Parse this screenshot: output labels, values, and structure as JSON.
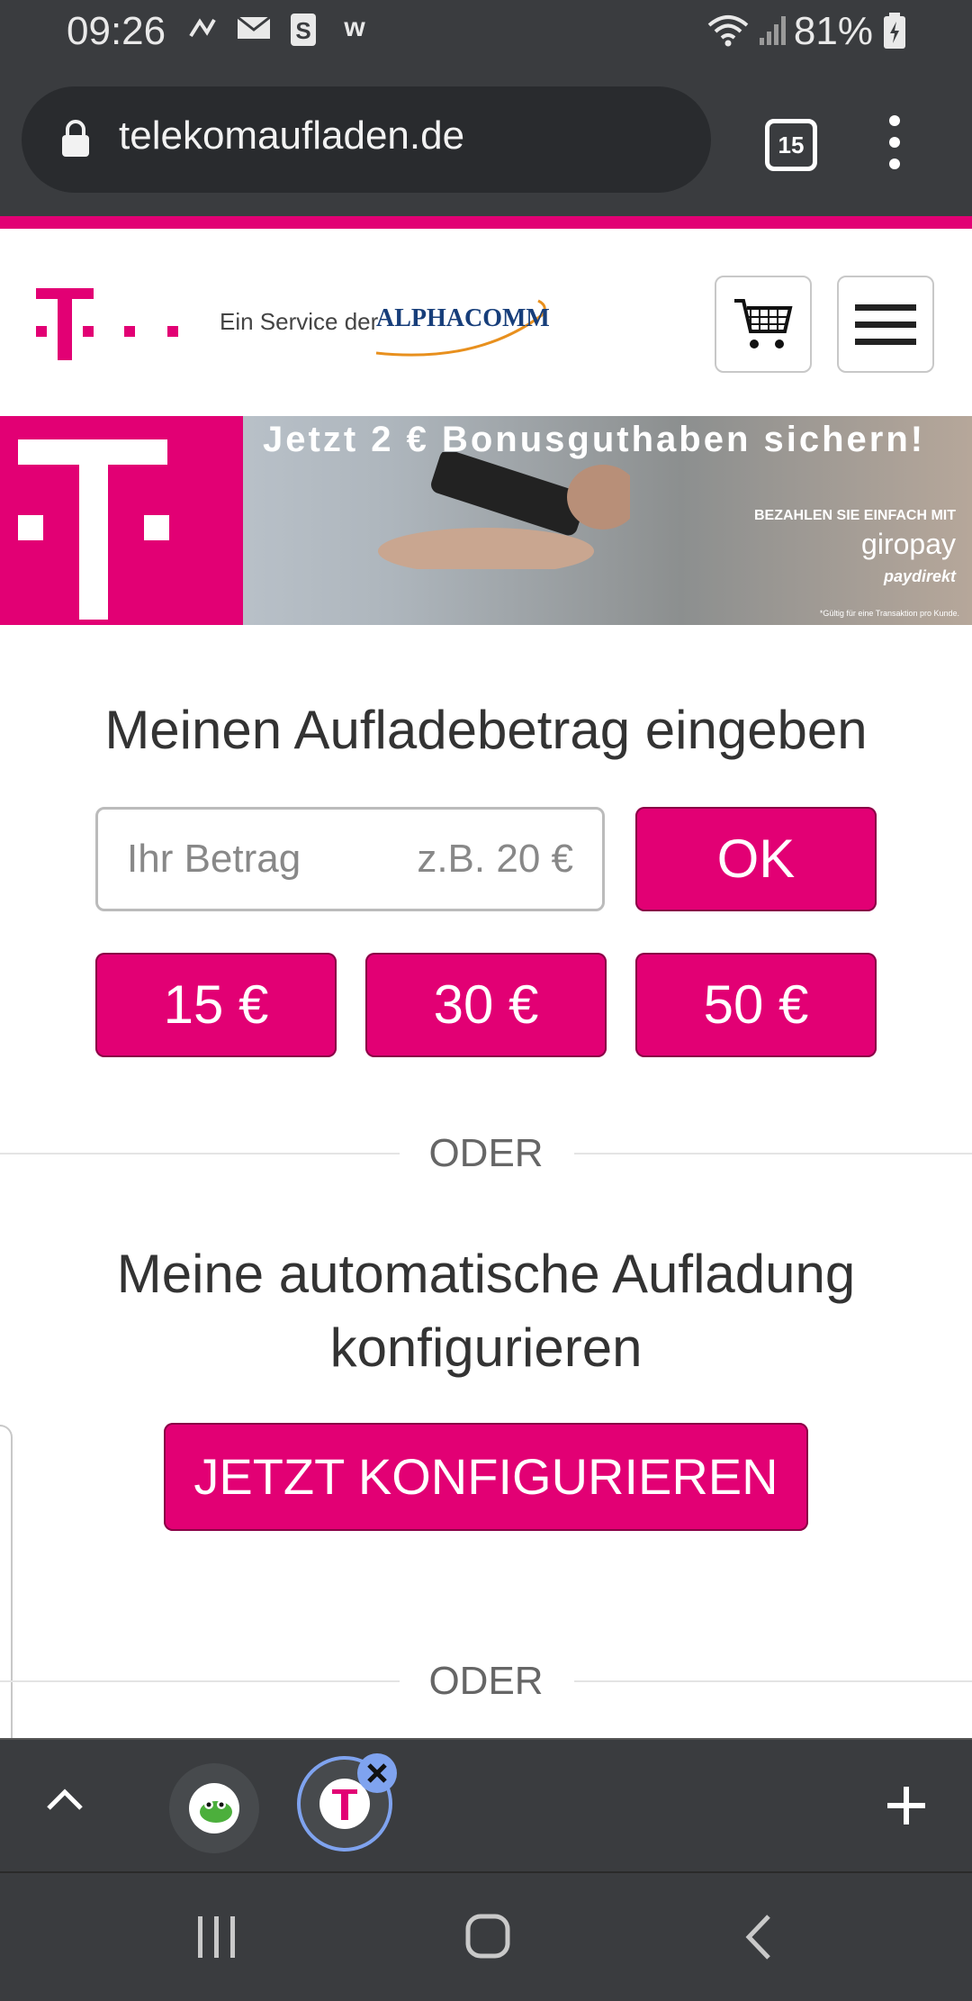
{
  "status_bar": {
    "time": "09:26",
    "battery": "81%"
  },
  "browser": {
    "url": "telekomaufladen.de",
    "tab_count": "15"
  },
  "header": {
    "service_prefix": "Ein Service der",
    "partner_logo": "ALPHACOMM"
  },
  "banner": {
    "headline": "Jetzt 2 € Bonusguthaben sichern!",
    "pay_caption": "BEZAHLEN  SIE EINFACH MIT",
    "pay_method": "giropay",
    "pay_method2": "paydirekt",
    "footnote": "*Gültig für eine Transaktion pro Kunde."
  },
  "topup": {
    "heading": "Meinen Aufladebetrag eingeben",
    "input_placeholder": "Ihr Betrag",
    "input_example": "z.B. 20 €",
    "ok_label": "OK",
    "presets": [
      "15 €",
      "30 €",
      "50 €"
    ]
  },
  "separator_label": "ODER",
  "auto": {
    "heading_line1": "Meine automatische Aufladung",
    "heading_line2": "konfigurieren",
    "button_label": "JETZT KONFIGURIEREN"
  },
  "colors": {
    "brand_magenta": "#e20074",
    "chrome_dark": "#3a3c3f"
  }
}
